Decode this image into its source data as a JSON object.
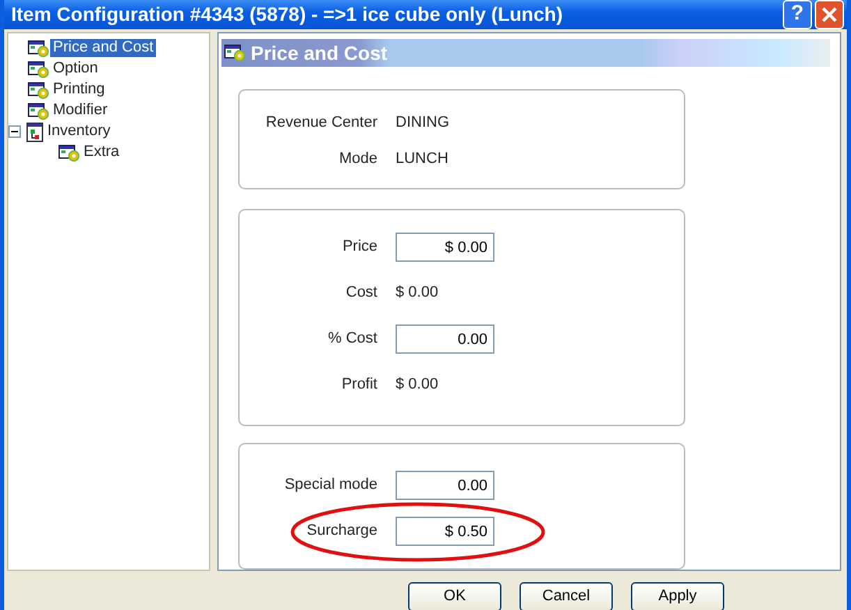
{
  "window": {
    "title": "Item Configuration #4343 (5878) - =>1 ice cube only (Lunch)",
    "help_button": "?"
  },
  "tree": [
    {
      "label": "Price and Cost",
      "selected": true,
      "kind": "page"
    },
    {
      "label": "Option",
      "selected": false,
      "kind": "page"
    },
    {
      "label": "Printing",
      "selected": false,
      "kind": "page"
    },
    {
      "label": "Modifier",
      "selected": false,
      "kind": "page"
    },
    {
      "label": "Inventory",
      "selected": false,
      "kind": "folder",
      "expanded": true,
      "children": [
        {
          "label": "Extra",
          "selected": false,
          "kind": "page"
        }
      ]
    }
  ],
  "page": {
    "title": "Price and Cost",
    "groups": [
      {
        "rows": [
          {
            "label": "Revenue Center",
            "kind": "text",
            "value": "DINING"
          },
          {
            "label": "Mode",
            "kind": "text",
            "value": "LUNCH"
          }
        ]
      },
      {
        "rows": [
          {
            "label": "Price",
            "kind": "input",
            "value": "$ 0.00"
          },
          {
            "label": "Cost",
            "kind": "text",
            "value": "$ 0.00"
          },
          {
            "label": "% Cost",
            "kind": "input",
            "value": "0.00"
          },
          {
            "label": "Profit",
            "kind": "text",
            "value": "$ 0.00"
          }
        ]
      },
      {
        "rows": [
          {
            "label": "Special mode",
            "kind": "input",
            "value": "0.00"
          },
          {
            "label": "Surcharge",
            "kind": "input",
            "value": "$ 0.50",
            "circled": true
          }
        ]
      }
    ]
  },
  "buttons": [
    "OK",
    "Cancel",
    "Apply"
  ]
}
